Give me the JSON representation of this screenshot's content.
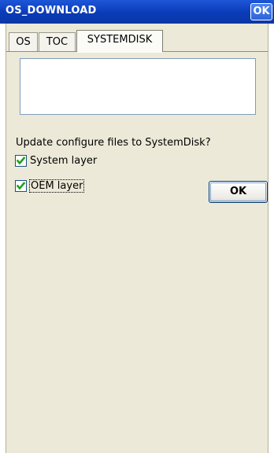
{
  "window": {
    "title": "OS_DOWNLOAD",
    "title_ok_label": "OK"
  },
  "tabs": [
    {
      "label": "OS",
      "selected": false
    },
    {
      "label": "TOC",
      "selected": false
    },
    {
      "label": "SYSTEMDISK",
      "selected": true
    }
  ],
  "textbox": {
    "value": ""
  },
  "form": {
    "prompt": "Update configure files to SystemDisk?",
    "options": [
      {
        "label": "System layer",
        "checked": true
      },
      {
        "label": "OEM layer",
        "checked": true
      }
    ],
    "ok_label": "OK"
  },
  "colors": {
    "title_bar": "#0a3bb8",
    "client_bg": "#ece9d8",
    "check_mark": "#21a121"
  }
}
